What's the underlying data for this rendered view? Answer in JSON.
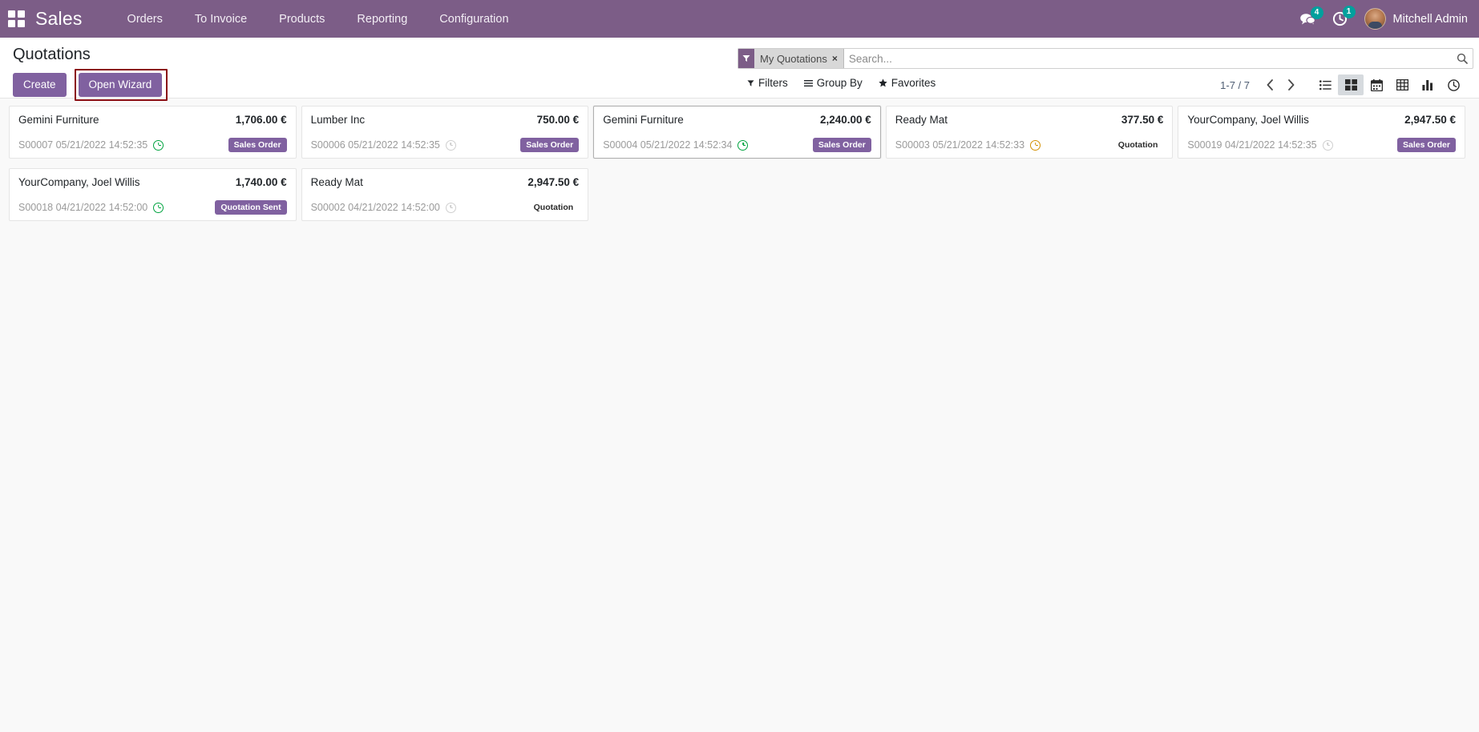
{
  "navbar": {
    "apps_icon": "apps-grid-icon",
    "brand": "Sales",
    "menu": [
      {
        "label": "Orders"
      },
      {
        "label": "To Invoice"
      },
      {
        "label": "Products"
      },
      {
        "label": "Reporting"
      },
      {
        "label": "Configuration"
      }
    ],
    "messages_icon": "messages-icon",
    "messages_count": "4",
    "activities_icon": "activities-clock-icon",
    "activities_count": "1",
    "user_name": "Mitchell Admin",
    "bg_color": "#7C5D87"
  },
  "control_panel": {
    "title": "Quotations",
    "create_label": "Create",
    "wizard_label": "Open Wizard",
    "highlight_color": "#8B0D13",
    "search": {
      "facet_icon": "filter-funnel-icon",
      "facet_label": "My Quotations",
      "facet_remove_icon": "×",
      "placeholder": "Search...",
      "value": "",
      "magnifier_icon": "search-icon"
    },
    "sub_buttons": [
      {
        "label": "Filters",
        "icon": "filter-funnel-icon"
      },
      {
        "label": "Group By",
        "icon": "list-bars-icon"
      },
      {
        "label": "Favorites",
        "icon": "star-icon"
      }
    ],
    "pager": {
      "count": "1-7 / 7",
      "prev_icon": "chevron-left-icon",
      "next_icon": "chevron-right-icon"
    },
    "views": [
      {
        "name": "list",
        "icon": "list-view-icon",
        "active": false
      },
      {
        "name": "kanban",
        "icon": "kanban-view-icon",
        "active": true
      },
      {
        "name": "calendar",
        "icon": "calendar-view-icon",
        "active": false
      },
      {
        "name": "pivot",
        "icon": "pivot-view-icon",
        "active": false
      },
      {
        "name": "graph",
        "icon": "graph-view-icon",
        "active": false
      },
      {
        "name": "activity",
        "icon": "activity-view-icon",
        "active": false
      }
    ]
  },
  "kanban": {
    "cards": [
      {
        "partner": "Gemini Furniture",
        "amount": "1,706.00 €",
        "reference": "S00007 05/21/2022 14:52:35",
        "activity_state": "green",
        "state_label": "Sales Order",
        "state_style": "badge",
        "focused": false
      },
      {
        "partner": "Lumber Inc",
        "amount": "750.00 €",
        "reference": "S00006 05/21/2022 14:52:35",
        "activity_state": "grey",
        "state_label": "Sales Order",
        "state_style": "badge",
        "focused": false
      },
      {
        "partner": "Gemini Furniture",
        "amount": "2,240.00 €",
        "reference": "S00004 05/21/2022 14:52:34",
        "activity_state": "green",
        "state_label": "Sales Order",
        "state_style": "badge",
        "focused": true
      },
      {
        "partner": "Ready Mat",
        "amount": "377.50 €",
        "reference": "S00003 05/21/2022 14:52:33",
        "activity_state": "orange",
        "state_label": "Quotation",
        "state_style": "plain",
        "focused": false
      },
      {
        "partner": "YourCompany, Joel Willis",
        "amount": "2,947.50 €",
        "reference": "S00019 04/21/2022 14:52:35",
        "activity_state": "grey",
        "state_label": "Sales Order",
        "state_style": "badge",
        "focused": false
      },
      {
        "partner": "YourCompany, Joel Willis",
        "amount": "1,740.00 €",
        "reference": "S00018 04/21/2022 14:52:00",
        "activity_state": "green",
        "state_label": "Quotation Sent",
        "state_style": "badge",
        "focused": false
      },
      {
        "partner": "Ready Mat",
        "amount": "2,947.50 €",
        "reference": "S00002 04/21/2022 14:52:00",
        "activity_state": "grey",
        "state_label": "Quotation",
        "state_style": "plain",
        "focused": false
      }
    ]
  }
}
